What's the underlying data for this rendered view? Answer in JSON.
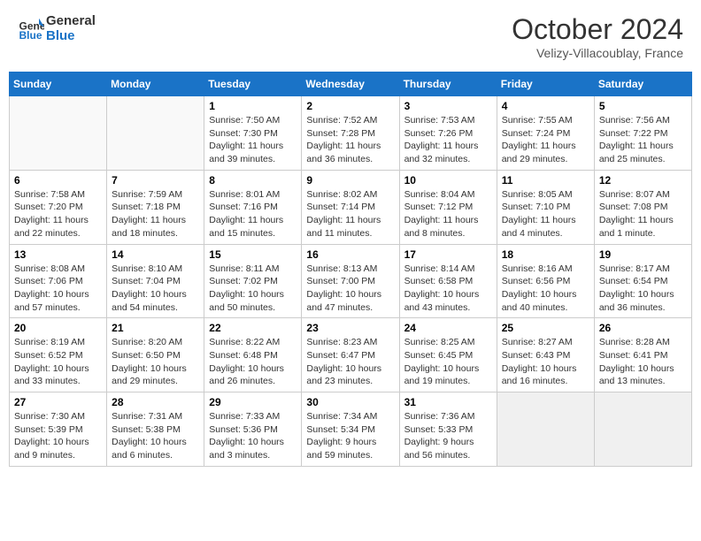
{
  "header": {
    "logo_line1": "General",
    "logo_line2": "Blue",
    "month": "October 2024",
    "location": "Velizy-Villacoublay, France"
  },
  "weekdays": [
    "Sunday",
    "Monday",
    "Tuesday",
    "Wednesday",
    "Thursday",
    "Friday",
    "Saturday"
  ],
  "weeks": [
    [
      {
        "day": "",
        "info": ""
      },
      {
        "day": "",
        "info": ""
      },
      {
        "day": "1",
        "info": "Sunrise: 7:50 AM\nSunset: 7:30 PM\nDaylight: 11 hours and 39 minutes."
      },
      {
        "day": "2",
        "info": "Sunrise: 7:52 AM\nSunset: 7:28 PM\nDaylight: 11 hours and 36 minutes."
      },
      {
        "day": "3",
        "info": "Sunrise: 7:53 AM\nSunset: 7:26 PM\nDaylight: 11 hours and 32 minutes."
      },
      {
        "day": "4",
        "info": "Sunrise: 7:55 AM\nSunset: 7:24 PM\nDaylight: 11 hours and 29 minutes."
      },
      {
        "day": "5",
        "info": "Sunrise: 7:56 AM\nSunset: 7:22 PM\nDaylight: 11 hours and 25 minutes."
      }
    ],
    [
      {
        "day": "6",
        "info": "Sunrise: 7:58 AM\nSunset: 7:20 PM\nDaylight: 11 hours and 22 minutes."
      },
      {
        "day": "7",
        "info": "Sunrise: 7:59 AM\nSunset: 7:18 PM\nDaylight: 11 hours and 18 minutes."
      },
      {
        "day": "8",
        "info": "Sunrise: 8:01 AM\nSunset: 7:16 PM\nDaylight: 11 hours and 15 minutes."
      },
      {
        "day": "9",
        "info": "Sunrise: 8:02 AM\nSunset: 7:14 PM\nDaylight: 11 hours and 11 minutes."
      },
      {
        "day": "10",
        "info": "Sunrise: 8:04 AM\nSunset: 7:12 PM\nDaylight: 11 hours and 8 minutes."
      },
      {
        "day": "11",
        "info": "Sunrise: 8:05 AM\nSunset: 7:10 PM\nDaylight: 11 hours and 4 minutes."
      },
      {
        "day": "12",
        "info": "Sunrise: 8:07 AM\nSunset: 7:08 PM\nDaylight: 11 hours and 1 minute."
      }
    ],
    [
      {
        "day": "13",
        "info": "Sunrise: 8:08 AM\nSunset: 7:06 PM\nDaylight: 10 hours and 57 minutes."
      },
      {
        "day": "14",
        "info": "Sunrise: 8:10 AM\nSunset: 7:04 PM\nDaylight: 10 hours and 54 minutes."
      },
      {
        "day": "15",
        "info": "Sunrise: 8:11 AM\nSunset: 7:02 PM\nDaylight: 10 hours and 50 minutes."
      },
      {
        "day": "16",
        "info": "Sunrise: 8:13 AM\nSunset: 7:00 PM\nDaylight: 10 hours and 47 minutes."
      },
      {
        "day": "17",
        "info": "Sunrise: 8:14 AM\nSunset: 6:58 PM\nDaylight: 10 hours and 43 minutes."
      },
      {
        "day": "18",
        "info": "Sunrise: 8:16 AM\nSunset: 6:56 PM\nDaylight: 10 hours and 40 minutes."
      },
      {
        "day": "19",
        "info": "Sunrise: 8:17 AM\nSunset: 6:54 PM\nDaylight: 10 hours and 36 minutes."
      }
    ],
    [
      {
        "day": "20",
        "info": "Sunrise: 8:19 AM\nSunset: 6:52 PM\nDaylight: 10 hours and 33 minutes."
      },
      {
        "day": "21",
        "info": "Sunrise: 8:20 AM\nSunset: 6:50 PM\nDaylight: 10 hours and 29 minutes."
      },
      {
        "day": "22",
        "info": "Sunrise: 8:22 AM\nSunset: 6:48 PM\nDaylight: 10 hours and 26 minutes."
      },
      {
        "day": "23",
        "info": "Sunrise: 8:23 AM\nSunset: 6:47 PM\nDaylight: 10 hours and 23 minutes."
      },
      {
        "day": "24",
        "info": "Sunrise: 8:25 AM\nSunset: 6:45 PM\nDaylight: 10 hours and 19 minutes."
      },
      {
        "day": "25",
        "info": "Sunrise: 8:27 AM\nSunset: 6:43 PM\nDaylight: 10 hours and 16 minutes."
      },
      {
        "day": "26",
        "info": "Sunrise: 8:28 AM\nSunset: 6:41 PM\nDaylight: 10 hours and 13 minutes."
      }
    ],
    [
      {
        "day": "27",
        "info": "Sunrise: 7:30 AM\nSunset: 5:39 PM\nDaylight: 10 hours and 9 minutes."
      },
      {
        "day": "28",
        "info": "Sunrise: 7:31 AM\nSunset: 5:38 PM\nDaylight: 10 hours and 6 minutes."
      },
      {
        "day": "29",
        "info": "Sunrise: 7:33 AM\nSunset: 5:36 PM\nDaylight: 10 hours and 3 minutes."
      },
      {
        "day": "30",
        "info": "Sunrise: 7:34 AM\nSunset: 5:34 PM\nDaylight: 9 hours and 59 minutes."
      },
      {
        "day": "31",
        "info": "Sunrise: 7:36 AM\nSunset: 5:33 PM\nDaylight: 9 hours and 56 minutes."
      },
      {
        "day": "",
        "info": ""
      },
      {
        "day": "",
        "info": ""
      }
    ]
  ]
}
